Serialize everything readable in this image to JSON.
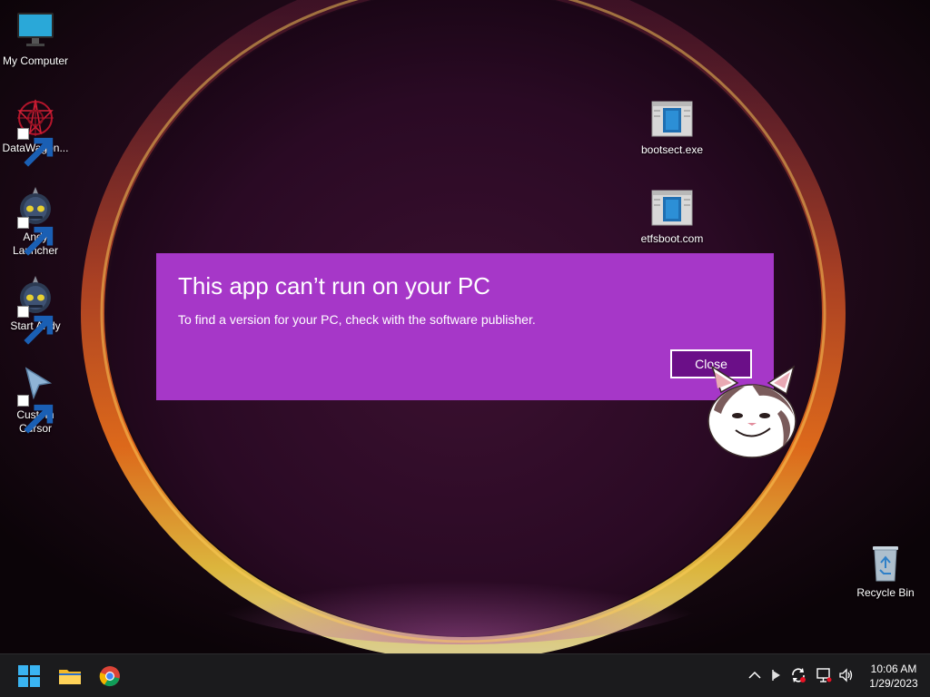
{
  "desktop": {
    "icons": [
      {
        "label": "My Computer",
        "icon": "monitor-icon"
      },
      {
        "label": "DataWagon...",
        "icon": "red-pattern-icon"
      },
      {
        "label": "Andy Launcher",
        "icon": "andy-robot-icon"
      },
      {
        "label": "Start Andy",
        "icon": "andy-robot-icon"
      },
      {
        "label": "Custom Cursor",
        "icon": "cursor-arrow-icon"
      },
      {
        "label": "bootsect.exe",
        "icon": "exe-window-icon"
      },
      {
        "label": "etfsboot.com",
        "icon": "exe-window-icon"
      },
      {
        "label": "Recycle Bin",
        "icon": "recycle-bin-icon"
      }
    ]
  },
  "dialog": {
    "title": "This app can’t run on your PC",
    "message": "To find a version for your PC, check with the software publisher.",
    "close_label": "Close",
    "background_color": "#a637c8",
    "button_color": "#6b0f88"
  },
  "taskbar": {
    "pinned": [
      {
        "name": "Start",
        "icon": "windows-logo-icon"
      },
      {
        "name": "File Explorer",
        "icon": "folder-icon"
      },
      {
        "name": "Google Chrome",
        "icon": "chrome-icon"
      }
    ],
    "tray": [
      "chevron-up-icon",
      "flag-icon",
      "sync-icon",
      "network-icon",
      "volume-icon"
    ],
    "time": "10:06 AM",
    "date": "1/29/2023"
  }
}
